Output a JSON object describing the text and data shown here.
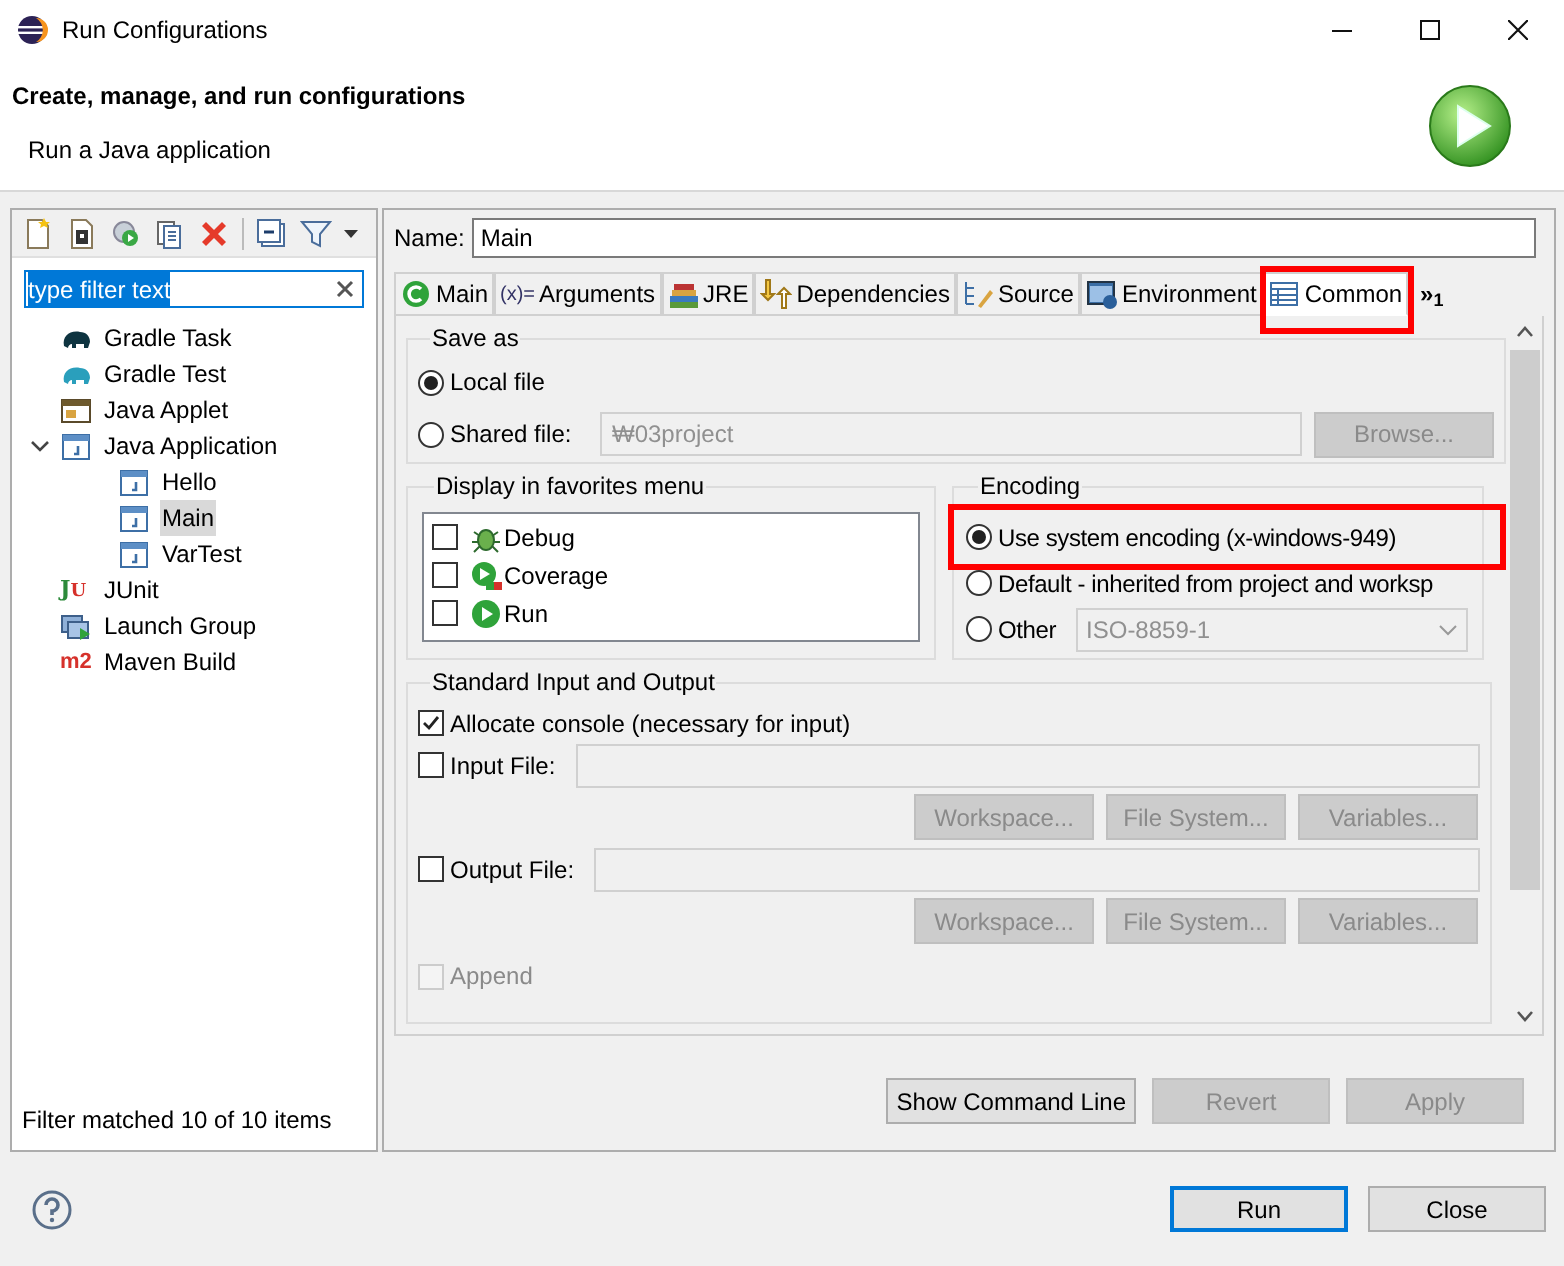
{
  "window": {
    "title": "Run Configurations"
  },
  "header": {
    "title": "Create, manage, and run configurations",
    "subtitle": "Run a Java application"
  },
  "filter": {
    "value": "type filter text",
    "selected": true
  },
  "tree": [
    {
      "label": "Gradle Task",
      "kind": "task",
      "selected": false
    },
    {
      "label": "Gradle Test",
      "kind": "test",
      "selected": false
    },
    {
      "label": "Java Applet",
      "kind": "applet",
      "selected": false
    },
    {
      "label": "Java Application",
      "kind": "application",
      "selected": false,
      "expanded": true,
      "children": [
        {
          "label": "Hello",
          "kind": "class",
          "selected": false
        },
        {
          "label": "Main",
          "kind": "class",
          "selected": true
        },
        {
          "label": "VarTest",
          "kind": "class",
          "selected": false
        }
      ]
    },
    {
      "label": "JUnit",
      "kind": "junit",
      "icon_text": "JU",
      "selected": false
    },
    {
      "label": "Launch Group",
      "kind": "group",
      "selected": false
    },
    {
      "label": "Maven Build",
      "kind": "maven",
      "icon_text": "m2",
      "selected": false
    }
  ],
  "filter_status": "Filter matched 10 of 10 items",
  "name": {
    "label": "Name:",
    "value": "Main"
  },
  "tabs": [
    {
      "label": "Main",
      "kind": "main",
      "selected": false,
      "highlighted": false
    },
    {
      "label": "Arguments",
      "kind": "arguments",
      "icon_text": "(x)=",
      "selected": false,
      "highlighted": false
    },
    {
      "label": "JRE",
      "kind": "jre",
      "selected": false,
      "highlighted": false
    },
    {
      "label": "Dependencies",
      "kind": "dependencies",
      "selected": false,
      "highlighted": false
    },
    {
      "label": "Source",
      "kind": "source",
      "selected": false,
      "highlighted": false
    },
    {
      "label": "Environment",
      "kind": "environment",
      "selected": false,
      "highlighted": false
    },
    {
      "label": "Common",
      "kind": "common",
      "selected": true,
      "highlighted": true
    }
  ],
  "tabs_overflow": "»$_{1}$",
  "save_as": {
    "title": "Save as",
    "options": [
      {
        "label": "Local file",
        "selected": true
      },
      {
        "label": "Shared file:",
        "selected": false
      }
    ],
    "shared_path": "₩03project",
    "browse": {
      "label": "Browse...",
      "disabled": true
    }
  },
  "favorites": {
    "title": "Display in favorites menu",
    "items": [
      {
        "label": "Debug",
        "kind": "debug",
        "checked": false
      },
      {
        "label": "Coverage",
        "kind": "coverage",
        "checked": false
      },
      {
        "label": "Run",
        "kind": "run",
        "checked": false
      }
    ]
  },
  "encoding": {
    "title": "Encoding",
    "options": [
      {
        "label": "Use system encoding (x-windows-949)",
        "selected": true,
        "highlighted": true
      },
      {
        "label": "Default - inherited from project and worksp",
        "selected": false,
        "highlighted": false
      },
      {
        "label": "Other",
        "selected": false,
        "highlighted": false
      }
    ],
    "other_value": "ISO-8859-1"
  },
  "stdio": {
    "title": "Standard Input and Output",
    "allocate": {
      "label": "Allocate console (necessary for input)",
      "checked": true
    },
    "input": {
      "label": "Input File:",
      "checked": false
    },
    "input_buttons": [
      {
        "label": "Workspace...",
        "disabled": true
      },
      {
        "label": "File System...",
        "disabled": true
      },
      {
        "label": "Variables...",
        "disabled": true
      }
    ],
    "output": {
      "label": "Output File:",
      "checked": false
    },
    "output_buttons": [
      {
        "label": "Workspace...",
        "disabled": true
      },
      {
        "label": "File System...",
        "disabled": true
      },
      {
        "label": "Variables...",
        "disabled": true
      }
    ],
    "append": {
      "label": "Append",
      "checked": false,
      "disabled": true
    }
  },
  "actions": [
    {
      "label": "Show Command Line",
      "disabled": false
    },
    {
      "label": "Revert",
      "disabled": true
    },
    {
      "label": "Apply",
      "disabled": true
    }
  ],
  "dialog_buttons": [
    {
      "label": "Run",
      "default": true
    },
    {
      "label": "Close",
      "default": false
    }
  ]
}
